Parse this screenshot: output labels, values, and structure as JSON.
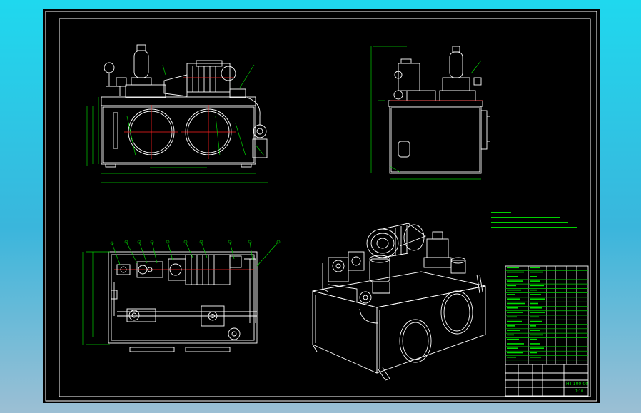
{
  "colors": {
    "background_gradient_top": "#1fd8ee",
    "background_gradient_bottom": "#9cbfd4",
    "canvas": "#000000",
    "lines": "#ffffff",
    "dimensions": "#00d000",
    "centerlines": "#ff2020"
  },
  "title_block": {
    "drawing_number": "HT-100-00",
    "sheet": "1:10"
  }
}
